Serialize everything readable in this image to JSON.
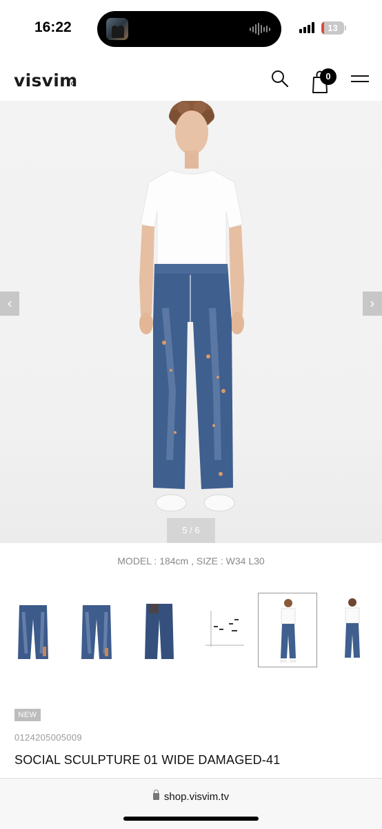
{
  "status_bar": {
    "time": "16:22",
    "battery_level": "13",
    "battery_color": "#e0483c",
    "icons": [
      "dynamic-island-media-thumb",
      "audio-waveform-icon",
      "signal-bars-icon",
      "battery-icon"
    ]
  },
  "header": {
    "logo": "visvim",
    "cart_count": "0",
    "icons": [
      "search-icon",
      "shopping-bag-icon",
      "menu-icon"
    ]
  },
  "gallery": {
    "slide_counter": "5 / 6",
    "prev_arrow": "‹",
    "next_arrow": "›",
    "caption": "MODEL : 184cm , SIZE : W34 L30",
    "thumbnails": [
      {
        "label": "jeans-front-flat"
      },
      {
        "label": "jeans-back-flat"
      },
      {
        "label": "jeans-side-flat"
      },
      {
        "label": "size-chart"
      },
      {
        "label": "model-front",
        "active": true
      },
      {
        "label": "model-back"
      }
    ]
  },
  "product": {
    "badge": "NEW",
    "code": "0124205005009",
    "name": "SOCIAL SCULPTURE 01 WIDE DAMAGED-41"
  },
  "browser": {
    "url": "shop.visvim.tv"
  }
}
